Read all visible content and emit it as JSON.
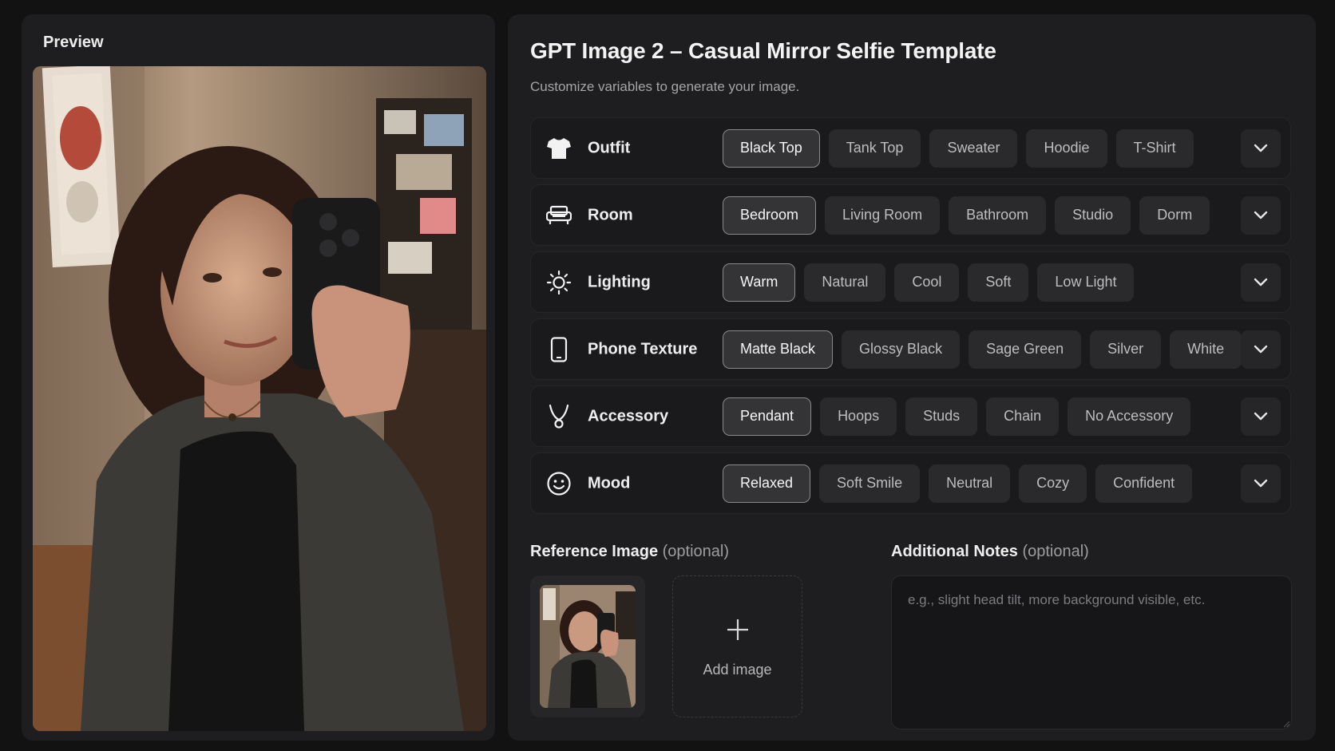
{
  "preview": {
    "label": "Preview"
  },
  "header": {
    "title": "GPT Image 2 – Casual Mirror Selfie Template",
    "subtitle": "Customize variables to generate your image."
  },
  "variables": [
    {
      "label": "Outfit",
      "icon": "tshirt-icon",
      "options": [
        "Black Top",
        "Tank Top",
        "Sweater",
        "Hoodie",
        "T-Shirt"
      ],
      "selected": "Black Top"
    },
    {
      "label": "Room",
      "icon": "sofa-icon",
      "options": [
        "Bedroom",
        "Living Room",
        "Bathroom",
        "Studio",
        "Dorm"
      ],
      "selected": "Bedroom"
    },
    {
      "label": "Lighting",
      "icon": "sun-icon",
      "options": [
        "Warm",
        "Natural",
        "Cool",
        "Soft",
        "Low Light"
      ],
      "selected": "Warm"
    },
    {
      "label": "Phone Texture",
      "icon": "phone-icon",
      "options": [
        "Matte Black",
        "Glossy Black",
        "Sage Green",
        "Silver",
        "White"
      ],
      "selected": "Matte Black"
    },
    {
      "label": "Accessory",
      "icon": "necklace-icon",
      "options": [
        "Pendant",
        "Hoops",
        "Studs",
        "Chain",
        "No Accessory"
      ],
      "selected": "Pendant"
    },
    {
      "label": "Mood",
      "icon": "smiley-icon",
      "options": [
        "Relaxed",
        "Soft Smile",
        "Neutral",
        "Cozy",
        "Confident"
      ],
      "selected": "Relaxed"
    }
  ],
  "reference": {
    "label": "Reference Image",
    "optional": "(optional)",
    "add_label": "Add image"
  },
  "notes": {
    "label": "Additional Notes",
    "optional": "(optional)",
    "placeholder": "e.g., slight head tilt, more background visible, etc."
  },
  "colors": {
    "background": "#121213",
    "panel": "#1e1e20",
    "chip": "#2a2a2c",
    "chip_selected_border": "#8a8a8d",
    "text": "#e9e9ea",
    "muted": "#a5a5a8"
  }
}
